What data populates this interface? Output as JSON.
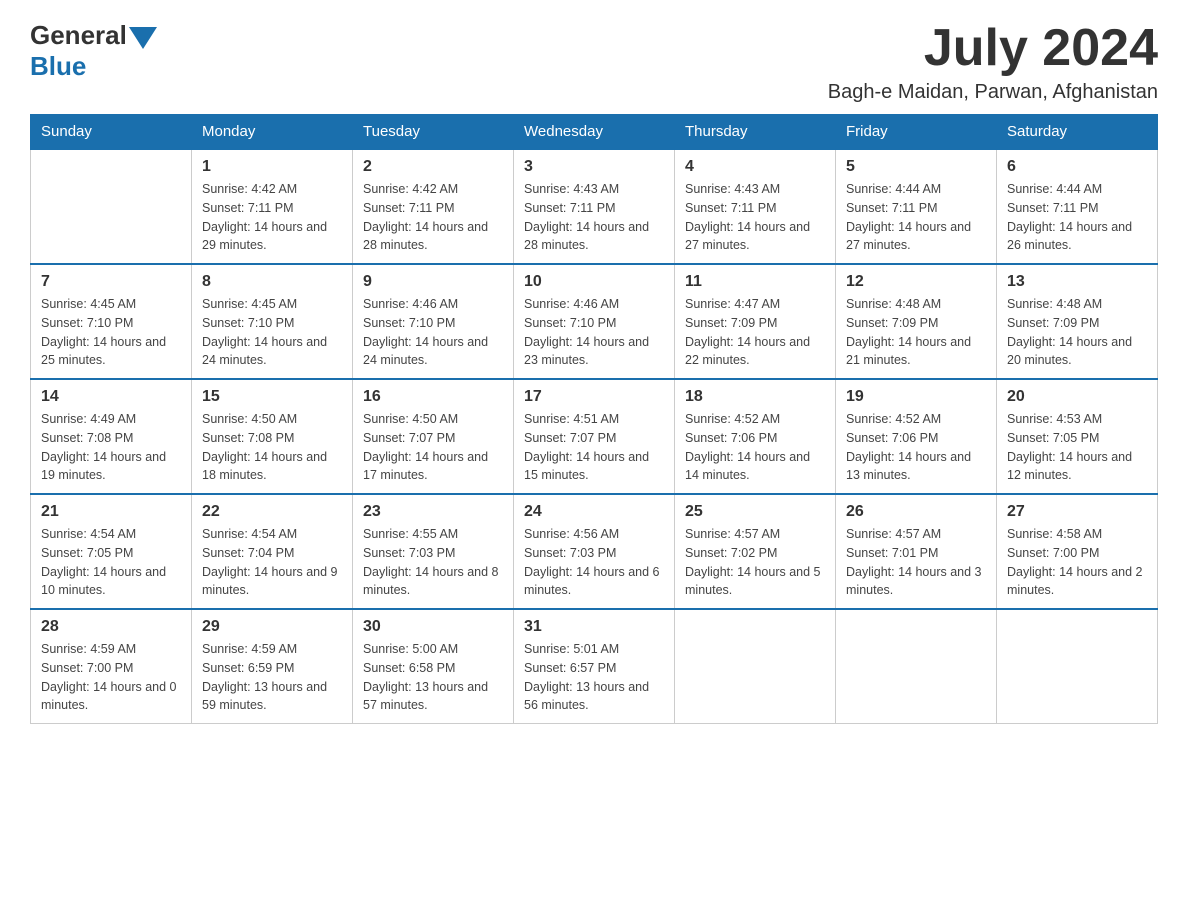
{
  "header": {
    "logo_general": "General",
    "logo_blue": "Blue",
    "month_title": "July 2024",
    "location": "Bagh-e Maidan, Parwan, Afghanistan"
  },
  "days_of_week": [
    "Sunday",
    "Monday",
    "Tuesday",
    "Wednesday",
    "Thursday",
    "Friday",
    "Saturday"
  ],
  "weeks": [
    [
      {
        "day": "",
        "sunrise": "",
        "sunset": "",
        "daylight": ""
      },
      {
        "day": "1",
        "sunrise": "Sunrise: 4:42 AM",
        "sunset": "Sunset: 7:11 PM",
        "daylight": "Daylight: 14 hours and 29 minutes."
      },
      {
        "day": "2",
        "sunrise": "Sunrise: 4:42 AM",
        "sunset": "Sunset: 7:11 PM",
        "daylight": "Daylight: 14 hours and 28 minutes."
      },
      {
        "day": "3",
        "sunrise": "Sunrise: 4:43 AM",
        "sunset": "Sunset: 7:11 PM",
        "daylight": "Daylight: 14 hours and 28 minutes."
      },
      {
        "day": "4",
        "sunrise": "Sunrise: 4:43 AM",
        "sunset": "Sunset: 7:11 PM",
        "daylight": "Daylight: 14 hours and 27 minutes."
      },
      {
        "day": "5",
        "sunrise": "Sunrise: 4:44 AM",
        "sunset": "Sunset: 7:11 PM",
        "daylight": "Daylight: 14 hours and 27 minutes."
      },
      {
        "day": "6",
        "sunrise": "Sunrise: 4:44 AM",
        "sunset": "Sunset: 7:11 PM",
        "daylight": "Daylight: 14 hours and 26 minutes."
      }
    ],
    [
      {
        "day": "7",
        "sunrise": "Sunrise: 4:45 AM",
        "sunset": "Sunset: 7:10 PM",
        "daylight": "Daylight: 14 hours and 25 minutes."
      },
      {
        "day": "8",
        "sunrise": "Sunrise: 4:45 AM",
        "sunset": "Sunset: 7:10 PM",
        "daylight": "Daylight: 14 hours and 24 minutes."
      },
      {
        "day": "9",
        "sunrise": "Sunrise: 4:46 AM",
        "sunset": "Sunset: 7:10 PM",
        "daylight": "Daylight: 14 hours and 24 minutes."
      },
      {
        "day": "10",
        "sunrise": "Sunrise: 4:46 AM",
        "sunset": "Sunset: 7:10 PM",
        "daylight": "Daylight: 14 hours and 23 minutes."
      },
      {
        "day": "11",
        "sunrise": "Sunrise: 4:47 AM",
        "sunset": "Sunset: 7:09 PM",
        "daylight": "Daylight: 14 hours and 22 minutes."
      },
      {
        "day": "12",
        "sunrise": "Sunrise: 4:48 AM",
        "sunset": "Sunset: 7:09 PM",
        "daylight": "Daylight: 14 hours and 21 minutes."
      },
      {
        "day": "13",
        "sunrise": "Sunrise: 4:48 AM",
        "sunset": "Sunset: 7:09 PM",
        "daylight": "Daylight: 14 hours and 20 minutes."
      }
    ],
    [
      {
        "day": "14",
        "sunrise": "Sunrise: 4:49 AM",
        "sunset": "Sunset: 7:08 PM",
        "daylight": "Daylight: 14 hours and 19 minutes."
      },
      {
        "day": "15",
        "sunrise": "Sunrise: 4:50 AM",
        "sunset": "Sunset: 7:08 PM",
        "daylight": "Daylight: 14 hours and 18 minutes."
      },
      {
        "day": "16",
        "sunrise": "Sunrise: 4:50 AM",
        "sunset": "Sunset: 7:07 PM",
        "daylight": "Daylight: 14 hours and 17 minutes."
      },
      {
        "day": "17",
        "sunrise": "Sunrise: 4:51 AM",
        "sunset": "Sunset: 7:07 PM",
        "daylight": "Daylight: 14 hours and 15 minutes."
      },
      {
        "day": "18",
        "sunrise": "Sunrise: 4:52 AM",
        "sunset": "Sunset: 7:06 PM",
        "daylight": "Daylight: 14 hours and 14 minutes."
      },
      {
        "day": "19",
        "sunrise": "Sunrise: 4:52 AM",
        "sunset": "Sunset: 7:06 PM",
        "daylight": "Daylight: 14 hours and 13 minutes."
      },
      {
        "day": "20",
        "sunrise": "Sunrise: 4:53 AM",
        "sunset": "Sunset: 7:05 PM",
        "daylight": "Daylight: 14 hours and 12 minutes."
      }
    ],
    [
      {
        "day": "21",
        "sunrise": "Sunrise: 4:54 AM",
        "sunset": "Sunset: 7:05 PM",
        "daylight": "Daylight: 14 hours and 10 minutes."
      },
      {
        "day": "22",
        "sunrise": "Sunrise: 4:54 AM",
        "sunset": "Sunset: 7:04 PM",
        "daylight": "Daylight: 14 hours and 9 minutes."
      },
      {
        "day": "23",
        "sunrise": "Sunrise: 4:55 AM",
        "sunset": "Sunset: 7:03 PM",
        "daylight": "Daylight: 14 hours and 8 minutes."
      },
      {
        "day": "24",
        "sunrise": "Sunrise: 4:56 AM",
        "sunset": "Sunset: 7:03 PM",
        "daylight": "Daylight: 14 hours and 6 minutes."
      },
      {
        "day": "25",
        "sunrise": "Sunrise: 4:57 AM",
        "sunset": "Sunset: 7:02 PM",
        "daylight": "Daylight: 14 hours and 5 minutes."
      },
      {
        "day": "26",
        "sunrise": "Sunrise: 4:57 AM",
        "sunset": "Sunset: 7:01 PM",
        "daylight": "Daylight: 14 hours and 3 minutes."
      },
      {
        "day": "27",
        "sunrise": "Sunrise: 4:58 AM",
        "sunset": "Sunset: 7:00 PM",
        "daylight": "Daylight: 14 hours and 2 minutes."
      }
    ],
    [
      {
        "day": "28",
        "sunrise": "Sunrise: 4:59 AM",
        "sunset": "Sunset: 7:00 PM",
        "daylight": "Daylight: 14 hours and 0 minutes."
      },
      {
        "day": "29",
        "sunrise": "Sunrise: 4:59 AM",
        "sunset": "Sunset: 6:59 PM",
        "daylight": "Daylight: 13 hours and 59 minutes."
      },
      {
        "day": "30",
        "sunrise": "Sunrise: 5:00 AM",
        "sunset": "Sunset: 6:58 PM",
        "daylight": "Daylight: 13 hours and 57 minutes."
      },
      {
        "day": "31",
        "sunrise": "Sunrise: 5:01 AM",
        "sunset": "Sunset: 6:57 PM",
        "daylight": "Daylight: 13 hours and 56 minutes."
      },
      {
        "day": "",
        "sunrise": "",
        "sunset": "",
        "daylight": ""
      },
      {
        "day": "",
        "sunrise": "",
        "sunset": "",
        "daylight": ""
      },
      {
        "day": "",
        "sunrise": "",
        "sunset": "",
        "daylight": ""
      }
    ]
  ]
}
